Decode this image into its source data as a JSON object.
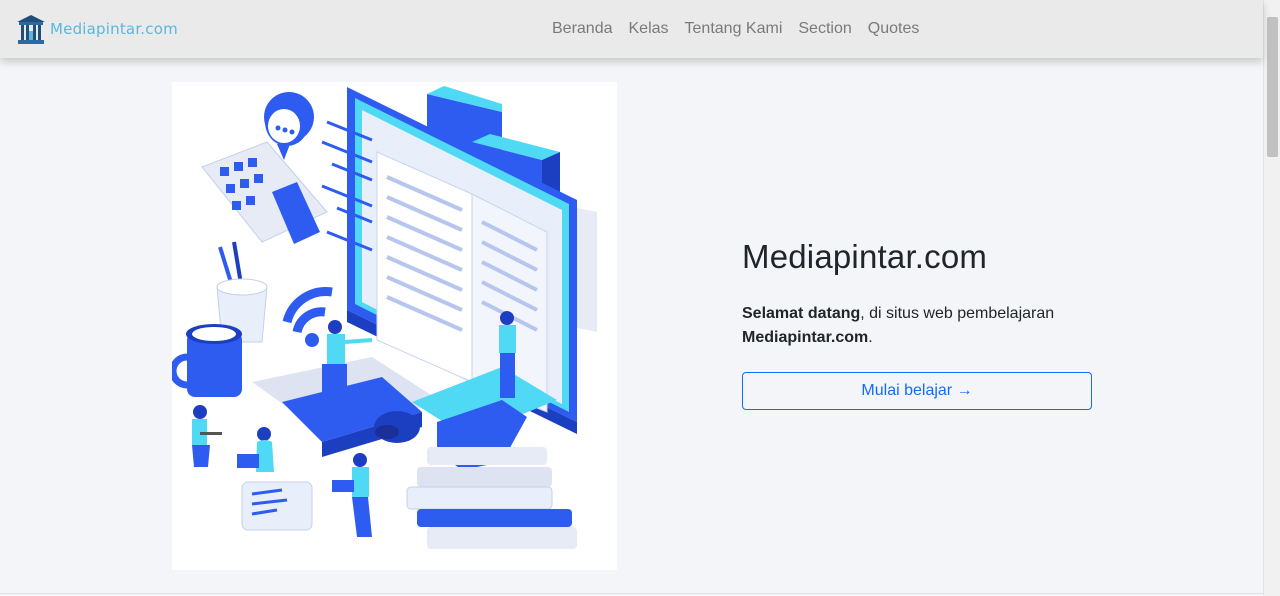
{
  "brand": {
    "name": "Mediapintar.com",
    "logo_icon": "school-building-icon"
  },
  "nav": {
    "items": [
      {
        "label": "Beranda"
      },
      {
        "label": "Kelas"
      },
      {
        "label": "Tentang Kami"
      },
      {
        "label": "Section"
      },
      {
        "label": "Quotes"
      }
    ]
  },
  "hero": {
    "title": "Mediapintar.com",
    "desc_bold1": "Selamat datang",
    "desc_middle": ", di situs web pembelajaran ",
    "desc_bold2": "Mediapintar.com",
    "desc_end": ".",
    "button_label": "Mulai belajar",
    "button_icon": "arrow-right-icon",
    "illustration": "isometric-online-learning-illustration"
  },
  "colors": {
    "accent": "#0d6efd",
    "brand": "#5bb7dc",
    "illustration_blue": "#2f5cf0",
    "illustration_cyan": "#4fd9f5"
  }
}
